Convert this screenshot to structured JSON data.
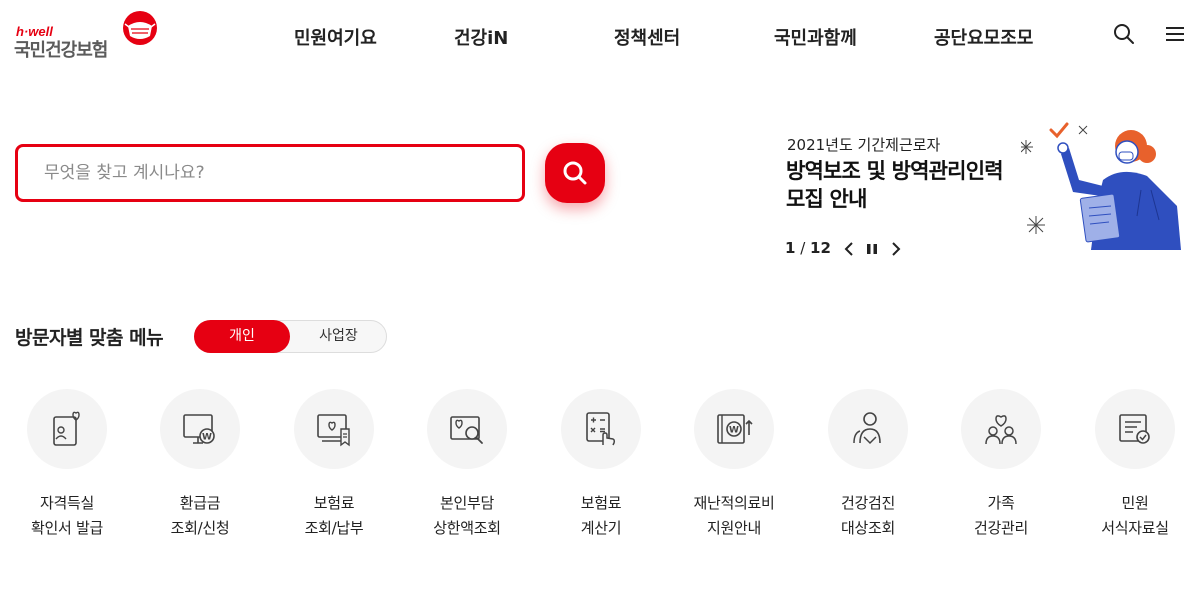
{
  "logo": {
    "small": "h·well",
    "main": "국민건강보험"
  },
  "nav": {
    "items": [
      "민원여기요",
      "건강iN",
      "정책센터",
      "국민과함께",
      "공단요모조모"
    ]
  },
  "search": {
    "placeholder": "무엇을 찾고 계시나요?"
  },
  "banner": {
    "subtitle": "2021년도 기간제근로자",
    "title_line1": "방역보조 및 방역관리인력",
    "title_line2": "모집 안내",
    "page_current": "1",
    "page_separator": " / ",
    "page_total": "12"
  },
  "menu": {
    "title": "방문자별 맞춤 메뉴",
    "toggle_on": "개인",
    "toggle_off": "사업장",
    "items": [
      {
        "line1": "자격득실",
        "line2": "확인서 발급",
        "icon": "certificate-icon"
      },
      {
        "line1": "환급금",
        "line2": "조회/신청",
        "icon": "refund-monitor-icon"
      },
      {
        "line1": "보험료",
        "line2": "조회/납부",
        "icon": "payment-icon"
      },
      {
        "line1": "본인부담",
        "line2": "상한액조회",
        "icon": "search-heart-icon"
      },
      {
        "line1": "보험료",
        "line2": "계산기",
        "icon": "calculator-icon"
      },
      {
        "line1": "재난적의료비",
        "line2": "지원안내",
        "icon": "medical-support-icon"
      },
      {
        "line1": "건강검진",
        "line2": "대상조회",
        "icon": "checkup-people-icon"
      },
      {
        "line1": "가족",
        "line2": "건강관리",
        "icon": "family-icon"
      },
      {
        "line1": "민원",
        "line2": "서식자료실",
        "icon": "forms-icon"
      }
    ]
  },
  "colors": {
    "brand_red": "#e60012",
    "icon_gray": "#444444",
    "circle_bg": "#f4f4f4",
    "illustration_blue": "#2f4fbf",
    "illustration_orange": "#e8612c"
  }
}
